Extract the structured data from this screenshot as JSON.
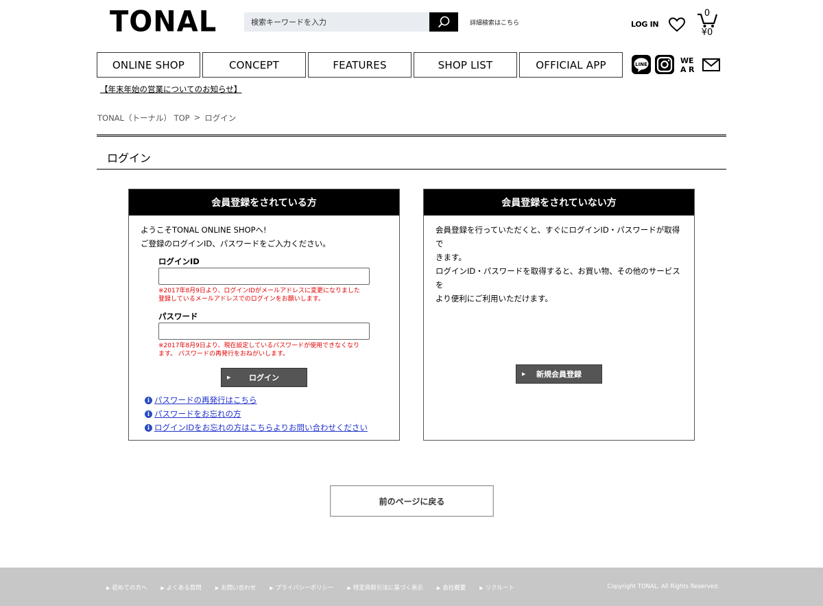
{
  "header": {
    "logo": "TONAL",
    "search_placeholder": "検索キーワードを入力",
    "advanced_search": "詳細検索はこちら",
    "login": "LOG IN",
    "cart_count": "0",
    "cart_total": "¥0"
  },
  "nav": {
    "items": [
      "ONLINE SHOP",
      "CONCEPT",
      "FEATURES",
      "SHOP LIST",
      "OFFICIAL APP"
    ],
    "social": [
      "line-icon",
      "instagram-icon",
      "wear-icon",
      "mail-icon"
    ],
    "wear_label": "WEAR"
  },
  "notice": "【年末年始の営業についてのお知らせ】",
  "breadcrumb": {
    "home": "TONAL（トーナル） TOP",
    "sep": ">",
    "current": "ログイン"
  },
  "page_title": "ログイン",
  "member": {
    "heading": "会員登録をされている方",
    "welcome_1": "ようこそTONAL ONLINE SHOPへ!",
    "welcome_2": "ご登録のログインID、パスワードをご入力ください。",
    "id_label": "ログインID",
    "id_note_1": "※2017年8月9日より、ログインIDがメールアドレスに変更になりました",
    "id_note_2": "登録しているメールアドレスでのログインをお願いします。",
    "pw_label": "パスワード",
    "pw_note_1": "※2017年8月9日より、現在設定しているパスワードが使用できなくなり",
    "pw_note_2": "ます。 パスワードの再発行をおねがいします。",
    "login_button": "ログイン",
    "links": [
      "パスワードの再発行はこちら",
      "パスワードをお忘れの方",
      "ログインIDをお忘れの方はこちらよりお問い合わせください"
    ]
  },
  "guest": {
    "heading": "会員登録をされていない方",
    "text_1": "会員登録を行っていただくと、すぐにログインID・パスワードが取得で",
    "text_2": "きます。",
    "text_3": "ログインID・パスワードを取得すると、お買い物、その他のサービスを",
    "text_4": "より便利にご利用いただけます。",
    "register_button": "新規会員登録"
  },
  "back_button": "前のページに戻る",
  "footer": {
    "links": [
      "初めての方へ",
      "よくある質問",
      "お問い合わせ",
      "プライバシーポリシー",
      "特定商取引法に基づく表示",
      "会社概要",
      "リクルート"
    ],
    "copyright": "Copyright TONAL. All Rights Reserved."
  }
}
